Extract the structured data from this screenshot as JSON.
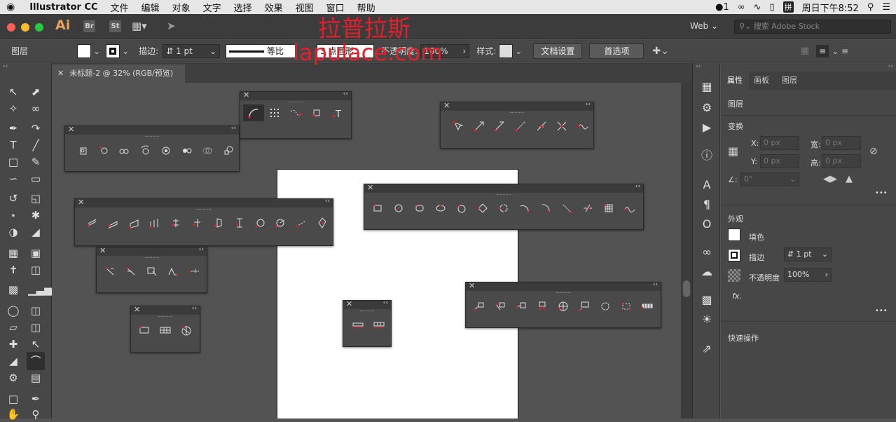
{
  "menubar": {
    "app_name": "Illustrator CC",
    "items": [
      "文件",
      "编辑",
      "对象",
      "文字",
      "选择",
      "效果",
      "视图",
      "窗口",
      "帮助"
    ],
    "status_battery_count": "1",
    "status_input": "拼",
    "clock": "周日下午8:52"
  },
  "titlebar": {
    "app_badge": "Ai",
    "bridge_badge": "Br",
    "stock_badge": "St",
    "workspace": "Web",
    "search_placeholder": "搜索 Adobe Stock"
  },
  "watermark": {
    "line1": "拉普拉斯",
    "line2": "lapulace.com"
  },
  "control_bar": {
    "layer_label": "图层",
    "stroke_label": "描边:",
    "stroke_value": "1 pt",
    "profile_label": "等比",
    "brush_label": "3 点圆形",
    "opacity_label": "不透明度:",
    "opacity_value": "100%",
    "style_label": "样式:",
    "doc_setup_button": "文档设置",
    "prefs_button": "首选项"
  },
  "document": {
    "tab_title": "未标题-2 @ 32% (RGB/预览)"
  },
  "right_panel": {
    "tabs": [
      "属性",
      "画板",
      "图层"
    ],
    "layer_section": "图层",
    "transform_section": "变换",
    "x_label": "X:",
    "x_value": "0 px",
    "y_label": "Y:",
    "y_value": "0 px",
    "w_label": "宽:",
    "w_value": "0 px",
    "h_label": "高:",
    "h_value": "0 px",
    "angle_value": "0°",
    "appearance_section": "外观",
    "fill_label": "填色",
    "stroke_label": "描边",
    "stroke_value": "1 pt",
    "opacity_label": "不透明度",
    "opacity_value": "100%",
    "fx_label": "fx.",
    "quick_actions": "快速操作",
    "more": "•••"
  },
  "colors": {
    "accent": "#e61e2b",
    "panel": "#474747",
    "dark": "#3c3c3c"
  }
}
